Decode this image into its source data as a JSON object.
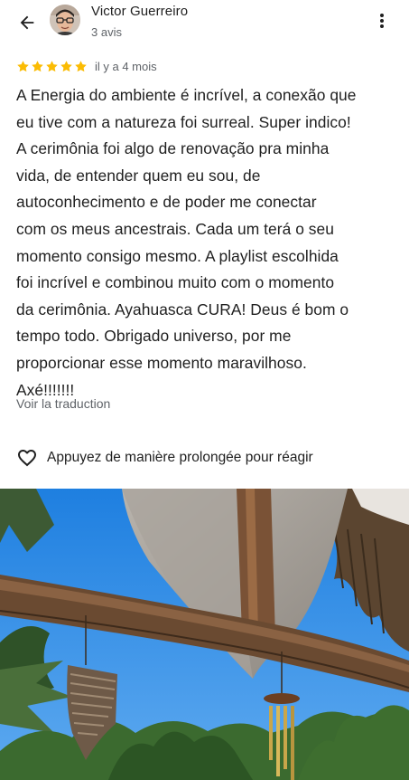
{
  "header": {
    "back_icon": "arrow-back-icon",
    "author_name": "Victor Guerreiro",
    "review_count": "3 avis",
    "more_icon": "more-vert-icon"
  },
  "review": {
    "rating": 5,
    "rating_max": 5,
    "date": "il y a 4 mois",
    "text": "A Energia do ambiente é incrível, a conexão que\neu tive com a natureza foi surreal. Super indico!\nA cerimônia foi algo de renovação pra minha\nvida, de entender quem eu sou, de\nautoconhecimento e de poder me conectar\ncom os meus ancestrais. Cada um terá o seu\nmomento consigo mesmo. A playlist escolhida\nfoi incrível e combinou muito com o momento\nda cerimônia. Ayahuasca CURA! Deus é bom o\ntempo todo. Obrigado universo, por me\nproporcionar esse momento maravilhoso.\nAxé!!!!!!!",
    "translate_label": "Voir la traduction"
  },
  "reaction": {
    "icon": "heart-outline-icon",
    "label": "Appuyez de manière prolongée pour réagir"
  },
  "colors": {
    "star": "#fbbc04",
    "text_primary": "#1f1f1f",
    "text_secondary": "#5f6368",
    "sky": "#2f8de4"
  }
}
